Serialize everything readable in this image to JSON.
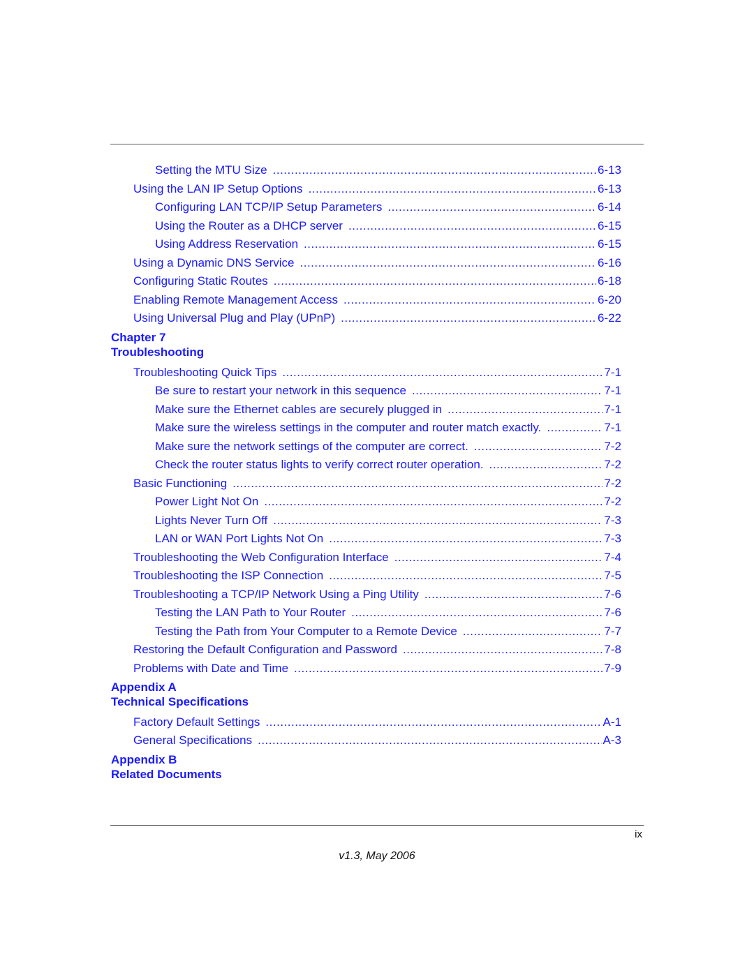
{
  "toc": {
    "entries": [
      {
        "level": 2,
        "title": "Setting the MTU Size",
        "page": "6-13"
      },
      {
        "level": 1,
        "title": "Using the LAN IP Setup Options",
        "page": "6-13"
      },
      {
        "level": 2,
        "title": "Configuring LAN TCP/IP Setup Parameters",
        "page": "6-14"
      },
      {
        "level": 2,
        "title": "Using the Router as a DHCP server",
        "page": "6-15"
      },
      {
        "level": 2,
        "title": "Using Address Reservation",
        "page": "6-15"
      },
      {
        "level": 1,
        "title": "Using a Dynamic DNS Service",
        "page": "6-16"
      },
      {
        "level": 1,
        "title": "Configuring Static Routes",
        "page": "6-18"
      },
      {
        "level": 1,
        "title": "Enabling Remote Management Access",
        "page": "6-20"
      },
      {
        "level": 1,
        "title": "Using Universal Plug and Play (UPnP)",
        "page": "6-22"
      }
    ],
    "chapter7": {
      "label": "Chapter 7",
      "title": "Troubleshooting",
      "entries": [
        {
          "level": 1,
          "title": "Troubleshooting Quick Tips",
          "page": "7-1"
        },
        {
          "level": 2,
          "title": "Be sure to restart your network in this sequence",
          "page": "7-1"
        },
        {
          "level": 2,
          "title": "Make sure the Ethernet cables are securely plugged in",
          "page": "7-1"
        },
        {
          "level": 2,
          "title": "Make sure the wireless settings in the computer and router match exactly.",
          "page": "7-1"
        },
        {
          "level": 2,
          "title": "Make sure the network settings of the computer are correct.",
          "page": "7-2"
        },
        {
          "level": 2,
          "title": "Check the router status lights to verify correct router operation.",
          "page": "7-2"
        },
        {
          "level": 1,
          "title": "Basic Functioning",
          "page": "7-2"
        },
        {
          "level": 2,
          "title": "Power Light Not On",
          "page": "7-2"
        },
        {
          "level": 2,
          "title": "Lights Never Turn Off",
          "page": "7-3"
        },
        {
          "level": 2,
          "title": "LAN or WAN Port Lights Not On",
          "page": "7-3"
        },
        {
          "level": 1,
          "title": "Troubleshooting the Web Configuration Interface",
          "page": "7-4"
        },
        {
          "level": 1,
          "title": "Troubleshooting the ISP Connection",
          "page": "7-5"
        },
        {
          "level": 1,
          "title": "Troubleshooting a TCP/IP Network Using a Ping Utility",
          "page": "7-6"
        },
        {
          "level": 2,
          "title": "Testing the LAN Path to Your Router",
          "page": "7-6"
        },
        {
          "level": 2,
          "title": "Testing the Path from Your Computer to a Remote Device",
          "page": "7-7"
        },
        {
          "level": 1,
          "title": "Restoring the Default Configuration and Password",
          "page": "7-8"
        },
        {
          "level": 1,
          "title": "Problems with Date and Time",
          "page": "7-9"
        }
      ]
    },
    "appendixA": {
      "label": "Appendix A",
      "title": "Technical Specifications",
      "entries": [
        {
          "level": 1,
          "title": "Factory Default Settings",
          "page": "A-1"
        },
        {
          "level": 1,
          "title": "General Specifications",
          "page": "A-3"
        }
      ]
    },
    "appendixB": {
      "label": "Appendix B",
      "title": "Related Documents"
    }
  },
  "footer": {
    "page_number": "ix",
    "version": "v1.3, May 2006"
  }
}
